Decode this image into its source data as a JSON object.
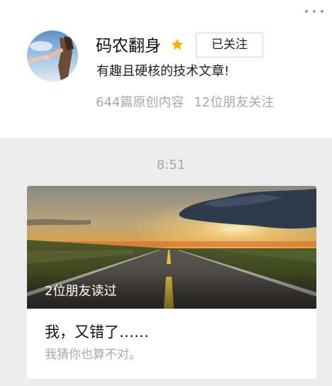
{
  "profile": {
    "name": "码农翻身",
    "follow_label": "已关注",
    "bio": "有趣且硬核的技术文章!",
    "stats": {
      "original_count": "644篇原创内容",
      "friends_following": "12位朋友关注"
    },
    "star_color": "#f5b400"
  },
  "message": {
    "time": "8:51"
  },
  "article": {
    "friends_read": "2位朋友读过",
    "title": "我，又错了……",
    "description": "我猜你也算不对。"
  },
  "icons": {
    "more": "more-horizontal-icon",
    "star": "star-icon"
  }
}
